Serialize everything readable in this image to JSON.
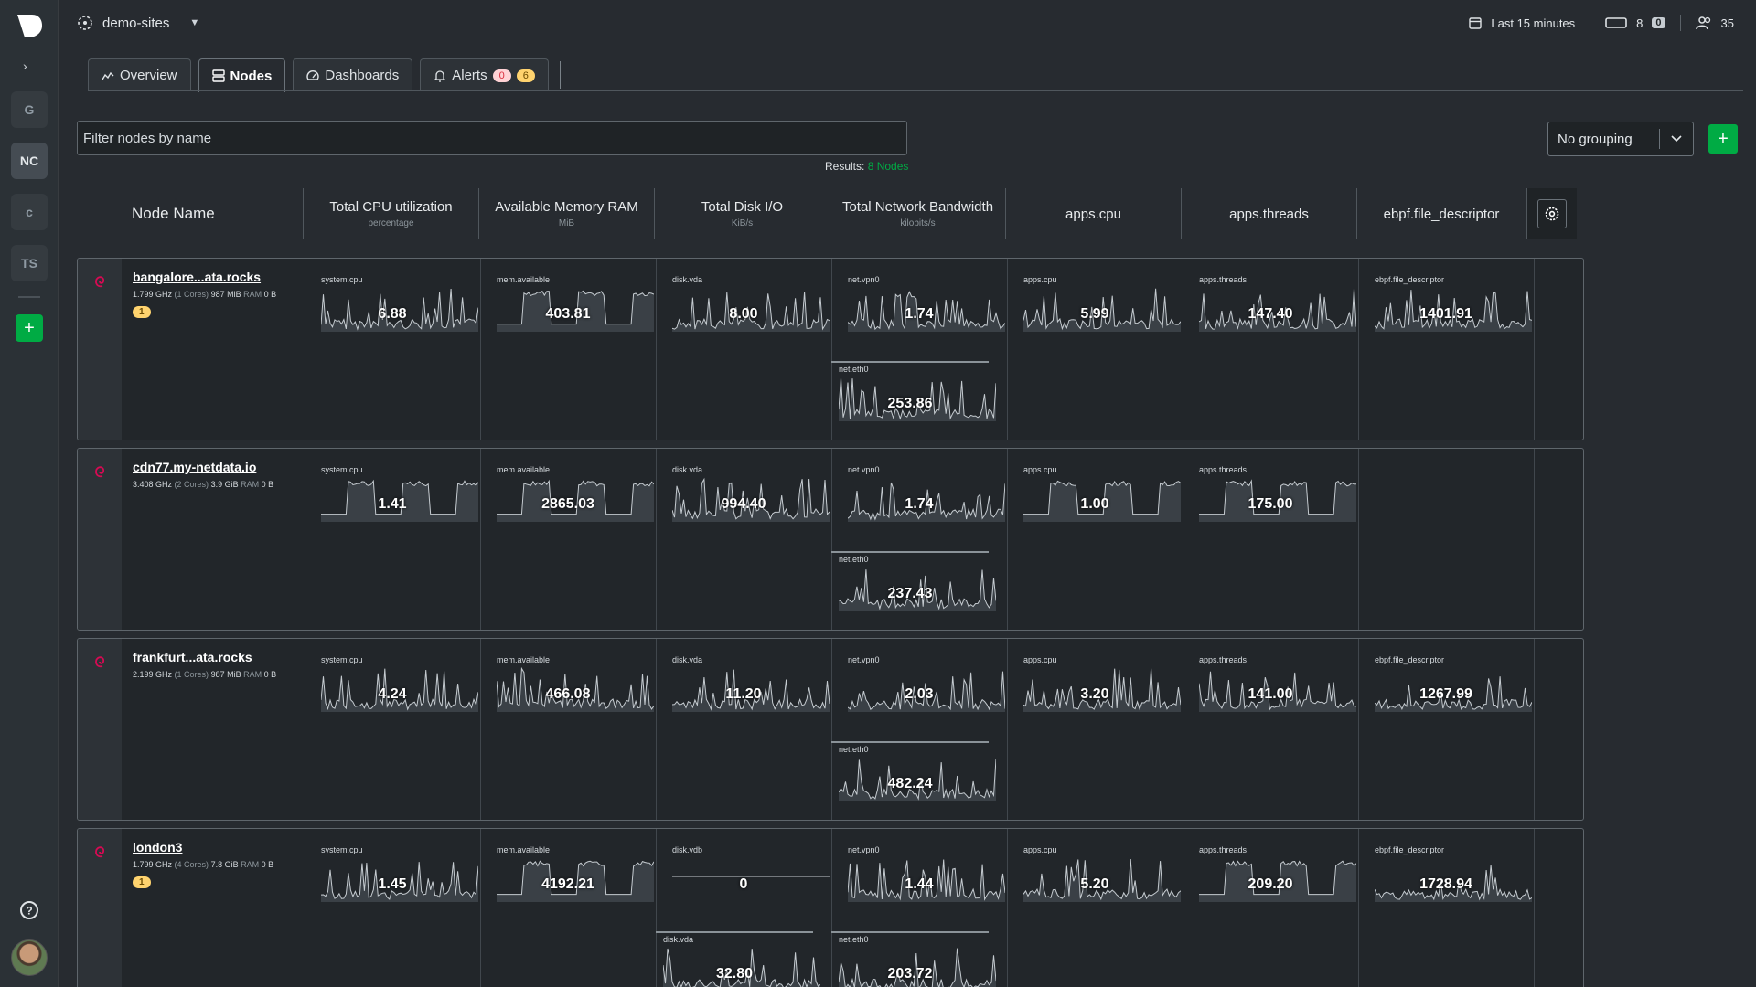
{
  "sidebar": {
    "spaces": [
      "G",
      "NC",
      "c",
      "TS"
    ]
  },
  "topbar": {
    "room": "demo-sites",
    "time_range": "Last 15 minutes",
    "nodes_count": "8",
    "offline_count": "0",
    "members_count": "35"
  },
  "tabs": {
    "overview": "Overview",
    "nodes": "Nodes",
    "dashboards": "Dashboards",
    "alerts": "Alerts",
    "alerts_critical": "0",
    "alerts_warning": "6"
  },
  "filter": {
    "placeholder": "Filter nodes by name"
  },
  "results": {
    "label": "Results:",
    "value": "8 Nodes"
  },
  "grouping": {
    "selected": "No grouping"
  },
  "columns": [
    {
      "title": "Node Name",
      "unit": ""
    },
    {
      "title": "Total CPU utilization",
      "unit": "percentage"
    },
    {
      "title": "Available Memory RAM",
      "unit": "MiB"
    },
    {
      "title": "Total Disk I/O",
      "unit": "KiB/s"
    },
    {
      "title": "Total Network Bandwidth",
      "unit": "kilobits/s"
    },
    {
      "title": "apps.cpu",
      "unit": ""
    },
    {
      "title": "apps.threads",
      "unit": ""
    },
    {
      "title": "ebpf.file_descriptor",
      "unit": ""
    }
  ],
  "nodes": [
    {
      "name": "bangalore...ata.rocks",
      "cpu": "1.799 GHz",
      "cores": "(1 Cores)",
      "ram": "987 MiB",
      "ram_label": "RAM",
      "disk": "0 B",
      "alerts": "1",
      "cpu_ctx": "system.cpu",
      "cpu_val": "6.88",
      "mem_ctx": "mem.available",
      "mem_val": "403.81",
      "disk_ctx": "disk.vda",
      "disk_val": "8.00",
      "net1_ctx": "net.vpn0",
      "net1_val": "1.74",
      "net2_ctx": "net.eth0",
      "net2_val": "253.86",
      "apps_ctx": "apps.cpu",
      "apps_val": "5.99",
      "thr_ctx": "apps.threads",
      "thr_val": "147.40",
      "fd_ctx": "ebpf.file_descriptor",
      "fd_val": "1401.91"
    },
    {
      "name": "cdn77.my-netdata.io",
      "cpu": "3.408 GHz",
      "cores": "(2 Cores)",
      "ram": "3.9 GiB",
      "ram_label": "RAM",
      "disk": "0 B",
      "alerts": "",
      "cpu_ctx": "system.cpu",
      "cpu_val": "1.41",
      "mem_ctx": "mem.available",
      "mem_val": "2865.03",
      "disk_ctx": "disk.vda",
      "disk_val": "994.40",
      "net1_ctx": "net.vpn0",
      "net1_val": "1.74",
      "net2_ctx": "net.eth0",
      "net2_val": "237.43",
      "apps_ctx": "apps.cpu",
      "apps_val": "1.00",
      "thr_ctx": "apps.threads",
      "thr_val": "175.00"
    },
    {
      "name": "frankfurt...ata.rocks",
      "cpu": "2.199 GHz",
      "cores": "(1 Cores)",
      "ram": "987 MiB",
      "ram_label": "RAM",
      "disk": "0 B",
      "alerts": "",
      "cpu_ctx": "system.cpu",
      "cpu_val": "4.24",
      "mem_ctx": "mem.available",
      "mem_val": "466.08",
      "disk_ctx": "disk.vda",
      "disk_val": "11.20",
      "net1_ctx": "net.vpn0",
      "net1_val": "2.03",
      "net2_ctx": "net.eth0",
      "net2_val": "482.24",
      "apps_ctx": "apps.cpu",
      "apps_val": "3.20",
      "thr_ctx": "apps.threads",
      "thr_val": "141.00",
      "fd_ctx": "ebpf.file_descriptor",
      "fd_val": "1267.99"
    },
    {
      "name": "london3",
      "cpu": "1.799 GHz",
      "cores": "(4 Cores)",
      "ram": "7.8 GiB",
      "ram_label": "RAM",
      "disk": "0 B",
      "alerts": "1",
      "cpu_ctx": "system.cpu",
      "cpu_val": "1.45",
      "mem_ctx": "mem.available",
      "mem_val": "4192.21",
      "disk_ctx": "disk.vdb",
      "disk_val": "0",
      "disk2_ctx": "disk.vda",
      "disk2_val": "32.80",
      "net1_ctx": "net.vpn0",
      "net1_val": "1.44",
      "net2_ctx": "net.eth0",
      "net2_val": "203.72",
      "apps_ctx": "apps.cpu",
      "apps_val": "5.20",
      "thr_ctx": "apps.threads",
      "thr_val": "209.20",
      "fd_ctx": "ebpf.file_descriptor",
      "fd_val": "1728.94"
    }
  ],
  "colors": {
    "accent": "#00ab44",
    "background": "#272b30",
    "sparkline": "#c5cbd0"
  }
}
